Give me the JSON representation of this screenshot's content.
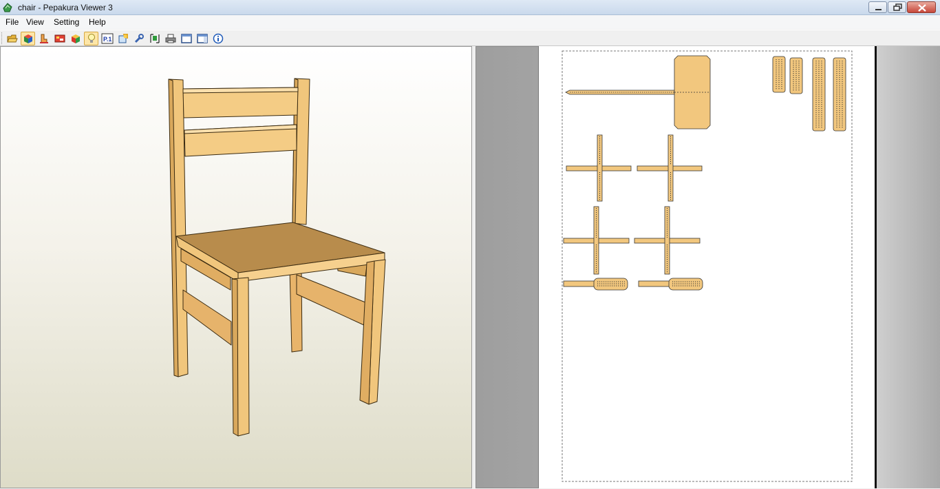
{
  "window": {
    "title": "chair - Pepakura Viewer 3",
    "controls": [
      "minimize",
      "restore",
      "close"
    ]
  },
  "menu": {
    "items": [
      "File",
      "View",
      "Setting",
      "Help"
    ]
  },
  "toolbar": {
    "buttons": [
      {
        "icon": "open-folder-icon",
        "pressed": false
      },
      {
        "icon": "3d-view-icon",
        "pressed": true
      },
      {
        "icon": "unfold-icon",
        "pressed": false
      },
      {
        "icon": "texture-icon",
        "pressed": false
      },
      {
        "icon": "cube-icon",
        "pressed": false
      },
      {
        "icon": "light-bulb-icon",
        "pressed": true
      },
      {
        "icon": "page-number-icon",
        "pressed": false,
        "label": "P.1"
      },
      {
        "icon": "settings-icon",
        "pressed": false
      },
      {
        "icon": "wrench-icon",
        "pressed": false
      },
      {
        "icon": "select-icon",
        "pressed": false
      },
      {
        "icon": "print-icon",
        "pressed": false
      },
      {
        "icon": "single-pane-icon",
        "pressed": false
      },
      {
        "icon": "split-pane-icon",
        "pressed": false
      },
      {
        "icon": "info-icon",
        "pressed": false
      }
    ]
  },
  "colors": {
    "wood_light": "#f2c77e",
    "wood_mid": "#e3b066",
    "wood_dark": "#c9954f",
    "seat_top": "#b68a48",
    "outline": "#222222",
    "accent_pressed": "#fde6a8"
  }
}
